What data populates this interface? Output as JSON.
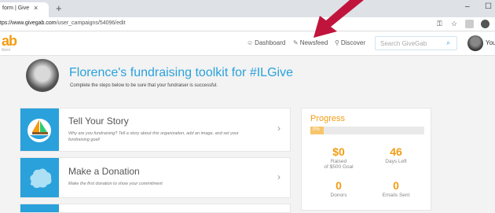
{
  "browser": {
    "tab_title": "form | Give",
    "tab_close": "×",
    "new_tab": "+",
    "url_host": "tps://www.givegab.com",
    "url_path": "/user_campaigns/54096/edit",
    "window_minimize": "–",
    "window_maximize": "☐"
  },
  "header": {
    "logo": "ab",
    "logo_sub": "tform",
    "nav": [
      {
        "icon": "☺",
        "label": "Dashboard"
      },
      {
        "icon": "✎",
        "label": "Newsfeed"
      },
      {
        "icon": "⚲",
        "label": "Discover"
      }
    ],
    "search_placeholder": "Search GiveGab",
    "search_icon": "⌕",
    "user_label": "You"
  },
  "hero": {
    "title": "Florence's fundraising toolkit for #ILGive",
    "subtitle": "Complete the steps below to be sure that your fundraiser is successful."
  },
  "steps": [
    {
      "title": "Tell Your Story",
      "desc": "Why are you fundraising? Tell a story about this organization, add an image, and set your fundraising goal!",
      "chevron": "›"
    },
    {
      "title": "Make a Donation",
      "desc": "Make the first donation to show your commitment",
      "chevron": "›"
    }
  ],
  "progress": {
    "title": "Progress",
    "percent_label": "0%",
    "percent_value": 0,
    "raised_value": "$0",
    "raised_label": "Raised",
    "raised_goal": "of $500 Goal",
    "days_value": "46",
    "days_label": "Days Left",
    "donors_value": "0",
    "donors_label": "Donors",
    "emails_value": "0",
    "emails_label": "Emails Sent"
  },
  "colors": {
    "brand_orange": "#f39c12",
    "brand_blue": "#2aa1db",
    "annotation_arrow": "#c0143c"
  },
  "icons": [
    "key-icon",
    "star-icon",
    "extension-icon",
    "boat-icon",
    "cloud-icon",
    "search-icon",
    "dashboard-icon",
    "newsfeed-icon",
    "discover-icon"
  ]
}
